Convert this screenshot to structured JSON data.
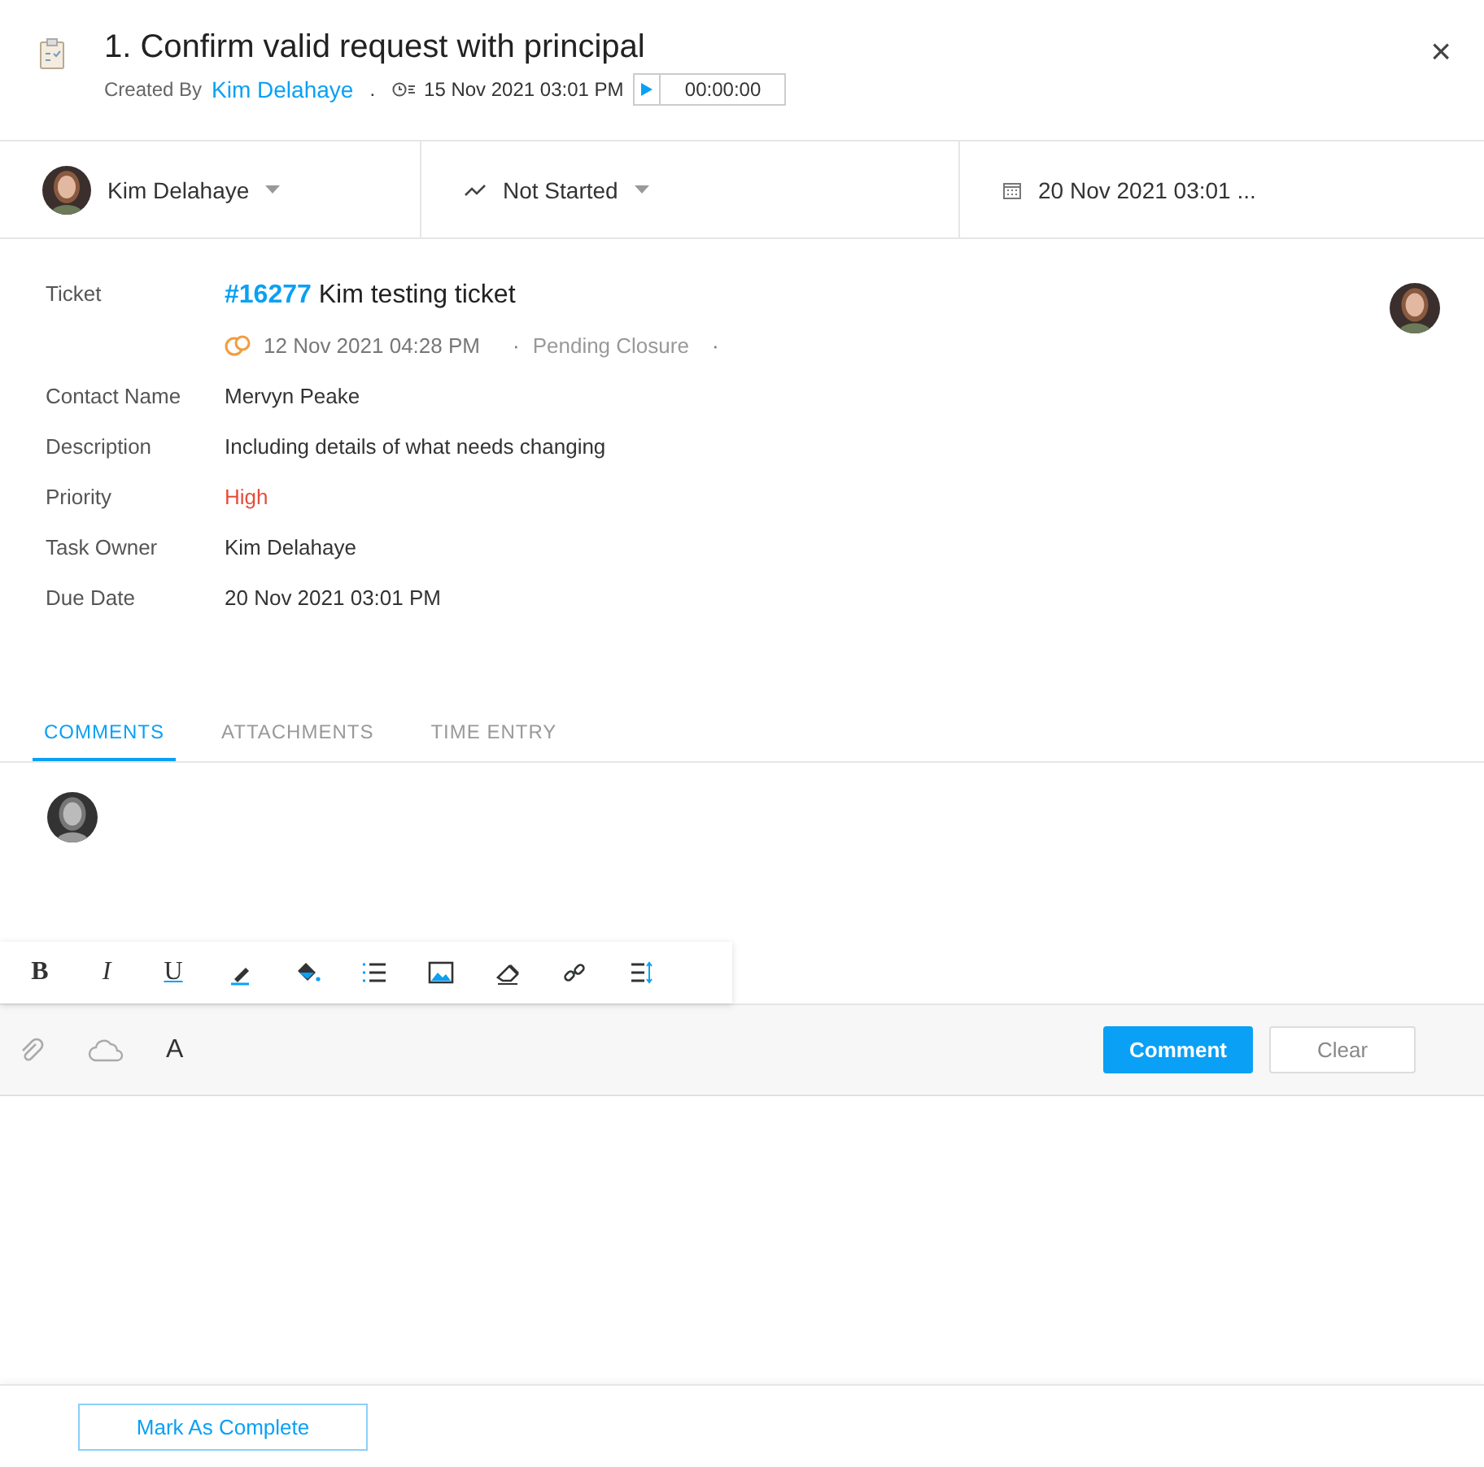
{
  "header": {
    "title": "1. Confirm valid request with principal",
    "created_by_label": "Created By",
    "created_by": "Kim Delahaye",
    "separator": ".",
    "created_at": "15 Nov 2021 03:01 PM",
    "timer": "00:00:00",
    "close": "×"
  },
  "assign_bar": {
    "owner": "Kim Delahaye",
    "status": "Not Started",
    "due": "20 Nov 2021 03:01 ..."
  },
  "fields": [
    {
      "kind": "ticket",
      "label": "Ticket",
      "number": "#16277",
      "value": "Kim testing ticket",
      "date": "12 Nov 2021 04:28 PM",
      "dot": "·",
      "status": "Pending Closure",
      "dot2": "·"
    },
    {
      "kind": "text",
      "label": "Contact Name",
      "value": "Mervyn Peake"
    },
    {
      "kind": "text",
      "label": "Description",
      "value": "Including details of what needs changing"
    },
    {
      "kind": "priority",
      "label": "Priority",
      "value": "High"
    },
    {
      "kind": "text",
      "label": "Task Owner",
      "value": "Kim Delahaye"
    },
    {
      "kind": "text",
      "label": "Due Date",
      "value": "20 Nov 2021 03:01 PM"
    }
  ],
  "tabs": [
    {
      "label": "COMMENTS",
      "selected": true
    },
    {
      "label": "ATTACHMENTS",
      "selected": false
    },
    {
      "label": "TIME ENTRY",
      "selected": false
    }
  ],
  "toolbar": {
    "bold": "B",
    "italic": "I",
    "underline": "U"
  },
  "compose": {
    "font": "A",
    "comment_button": "Comment",
    "clear_button": "Clear"
  },
  "footer": {
    "complete_button": "Mark As Complete"
  }
}
